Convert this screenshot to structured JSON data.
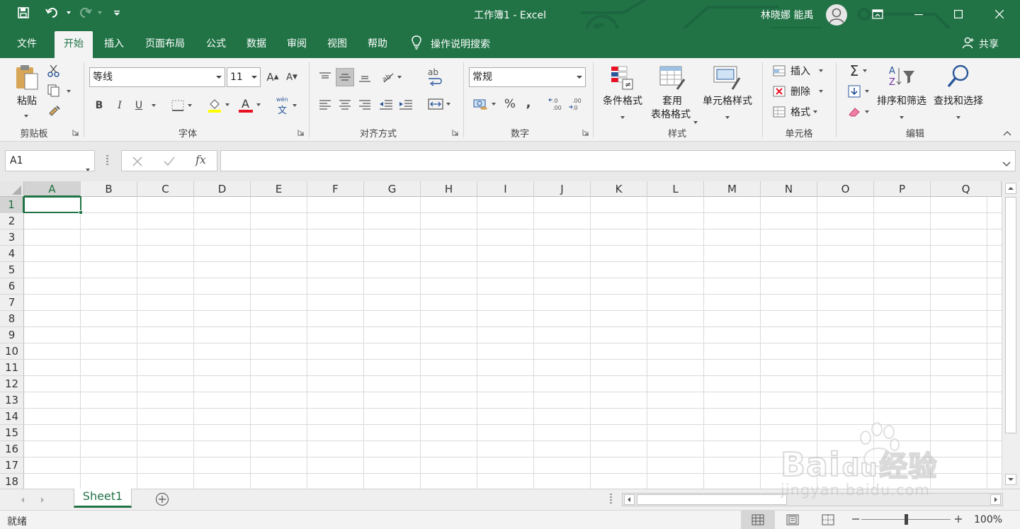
{
  "window": {
    "title": "工作簿1  -  Excel",
    "user_name": "林晓娜 能禹"
  },
  "quick_access": {
    "icons": [
      "save-icon",
      "undo-icon",
      "redo-icon",
      "customize-icon"
    ]
  },
  "tabs": [
    {
      "label": "文件",
      "active": false
    },
    {
      "label": "开始",
      "active": true
    },
    {
      "label": "插入",
      "active": false
    },
    {
      "label": "页面布局",
      "active": false
    },
    {
      "label": "公式",
      "active": false
    },
    {
      "label": "数据",
      "active": false
    },
    {
      "label": "审阅",
      "active": false
    },
    {
      "label": "视图",
      "active": false
    },
    {
      "label": "帮助",
      "active": false
    }
  ],
  "tell_me": "操作说明搜索",
  "share": "共享",
  "ribbon": {
    "clipboard": {
      "paste": "粘贴",
      "group_label": "剪贴板"
    },
    "font": {
      "font_name": "等线",
      "font_size": "11",
      "bold": "B",
      "italic": "I",
      "underline": "U",
      "grow": "A",
      "shrink": "A",
      "phonetic": "wén",
      "phonetic_char": "文",
      "font_color_letter": "A",
      "group_label": "字体"
    },
    "alignment": {
      "wrap": "ab",
      "group_label": "对齐方式"
    },
    "number": {
      "format": "常规",
      "percent": "%",
      "comma": ",",
      "inc_decimal": "←.0 .00",
      "dec_decimal": ".00 →.0",
      "group_label": "数字"
    },
    "styles": {
      "conditional": "条件格式",
      "table_format_1": "套用",
      "table_format_2": "表格格式",
      "cell_styles": "单元格样式",
      "group_label": "样式"
    },
    "cells": {
      "insert": "插入",
      "delete": "删除",
      "format": "格式",
      "group_label": "单元格"
    },
    "editing": {
      "sort": "排序和筛选",
      "find": "查找和选择",
      "group_label": "编辑"
    }
  },
  "formula_bar": {
    "name_box": "A1",
    "fx": "fx",
    "value": ""
  },
  "grid": {
    "columns": [
      "A",
      "B",
      "C",
      "D",
      "E",
      "F",
      "G",
      "H",
      "I",
      "J",
      "K",
      "L",
      "M",
      "N",
      "O",
      "P",
      "Q"
    ],
    "rows": [
      "1",
      "2",
      "3",
      "4",
      "5",
      "6",
      "7",
      "8",
      "9",
      "10",
      "11",
      "12",
      "13",
      "14",
      "15",
      "16",
      "17",
      "18"
    ],
    "active_cell": "A1"
  },
  "sheets": [
    {
      "name": "Sheet1",
      "active": true
    }
  ],
  "status": {
    "ready": "就绪",
    "zoom": "100%"
  },
  "watermark": {
    "text1": "Bai",
    "text2": "du",
    "text3": "经验",
    "url": "jingyan.baidu.com"
  },
  "colors": {
    "accent": "#217346",
    "ribbon": "#f3f3f3",
    "font_color": "#e81123",
    "fill_color": "#ffff00"
  }
}
